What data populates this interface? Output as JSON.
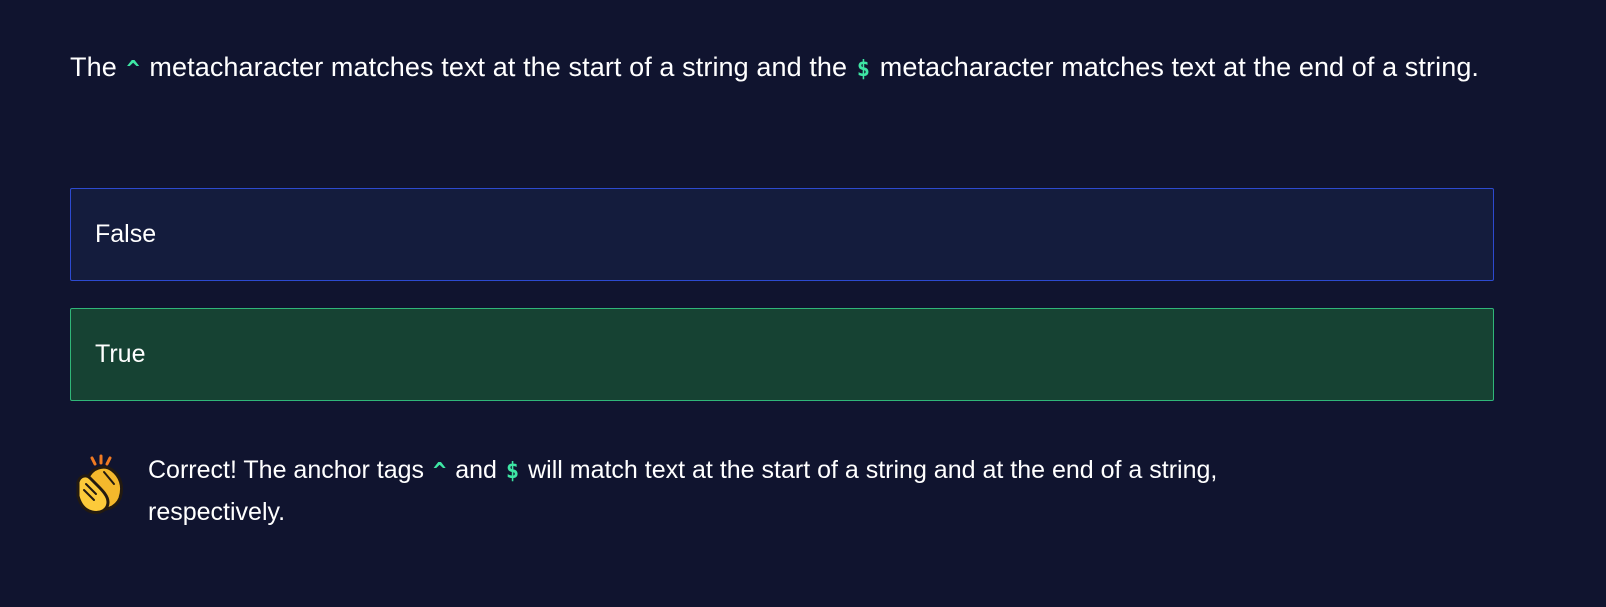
{
  "question": {
    "prefix": "The",
    "code_caret": "^",
    "middle": "metacharacter matches text at the start of a string and the",
    "code_dollar": "$",
    "suffix": "metacharacter matches text at the end of a string."
  },
  "options": [
    {
      "label": "False",
      "state": "default"
    },
    {
      "label": "True",
      "state": "correct"
    }
  ],
  "feedback": {
    "icon": "clapping-hands-icon",
    "prefix": "Correct! The anchor tags",
    "code_caret": "^",
    "middle": "and",
    "code_dollar": "$",
    "suffix": "will match text at the start of a string and at the end of a string, respectively."
  },
  "colors": {
    "background": "#10142f",
    "code_accent": "#3ee6a4",
    "option_border": "#2d4ad0",
    "correct_background": "#164233",
    "correct_border": "#30b678"
  }
}
